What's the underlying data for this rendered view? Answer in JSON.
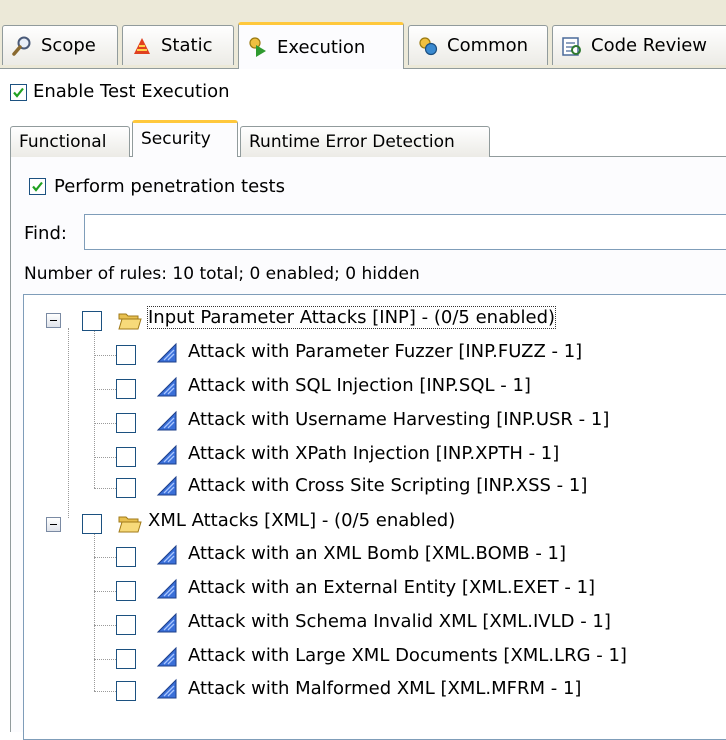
{
  "tabs": [
    {
      "label": "Scope",
      "icon": "scope-icon"
    },
    {
      "label": "Static",
      "icon": "static-icon"
    },
    {
      "label": "Execution",
      "icon": "execution-icon",
      "active": true
    },
    {
      "label": "Common",
      "icon": "common-icon"
    },
    {
      "label": "Code Review",
      "icon": "code-review-icon"
    }
  ],
  "enable_execution": {
    "label": "Enable Test Execution",
    "checked": true
  },
  "subtabs": [
    {
      "label": "Functional"
    },
    {
      "label": "Security",
      "active": true
    },
    {
      "label": "Runtime Error Detection"
    }
  ],
  "penetration": {
    "label": "Perform penetration tests",
    "checked": true
  },
  "find": {
    "label": "Find:",
    "value": ""
  },
  "rule_count": "Number of rules: 10 total; 0 enabled; 0 hidden",
  "tree": {
    "groups": [
      {
        "label": "Input Parameter Attacks [INP] - (0/5 enabled)",
        "expanded": true,
        "rules": [
          "Attack with Parameter Fuzzer [INP.FUZZ - 1]",
          "Attack with SQL Injection [INP.SQL - 1]",
          "Attack with Username Harvesting [INP.USR - 1]",
          "Attack with XPath Injection [INP.XPTH - 1]",
          "Attack with Cross Site Scripting [INP.XSS - 1]"
        ]
      },
      {
        "label": "XML Attacks [XML] - (0/5 enabled)",
        "expanded": true,
        "rules": [
          "Attack with an XML Bomb [XML.BOMB - 1]",
          "Attack with an External Entity [XML.EXET - 1]",
          "Attack with Schema Invalid XML [XML.IVLD - 1]",
          "Attack with Large XML Documents [XML.LRG - 1]",
          "Attack with Malformed XML [XML.MFRM - 1]"
        ]
      }
    ]
  },
  "colors": {
    "active_tab_accent": "#ffc83c",
    "checkmark": "#21a121",
    "tab_bar": "#ece9d8"
  }
}
